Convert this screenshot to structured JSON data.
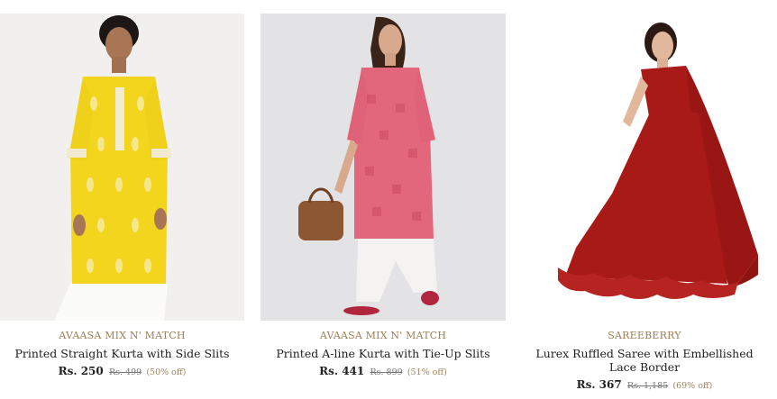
{
  "products": [
    {
      "brand": "AVAASA MIX N' MATCH",
      "name": "Printed Straight Kurta with Side Slits",
      "price": "Rs. 250",
      "mrp": "Rs. 499",
      "discount": "(50% off)",
      "image_desc_colors": {
        "main": "#f2d51c",
        "bg": "#f1f0ee"
      }
    },
    {
      "brand": "AVAASA MIX N' MATCH",
      "name": "Printed A-line Kurta with Tie-Up Slits",
      "price": "Rs. 441",
      "mrp": "Rs. 899",
      "discount": "(51% off)",
      "image_desc_colors": {
        "main": "#e2677d",
        "bg": "#e3e3e5"
      }
    },
    {
      "brand": "SAREEBERRY",
      "name": "Lurex Ruffled Saree with Embellished Lace Border",
      "price": "Rs. 367",
      "mrp": "Rs. 1,185",
      "discount": "(69% off)",
      "image_desc_colors": {
        "main": "#a81a17",
        "bg": "#ffffff"
      }
    }
  ]
}
